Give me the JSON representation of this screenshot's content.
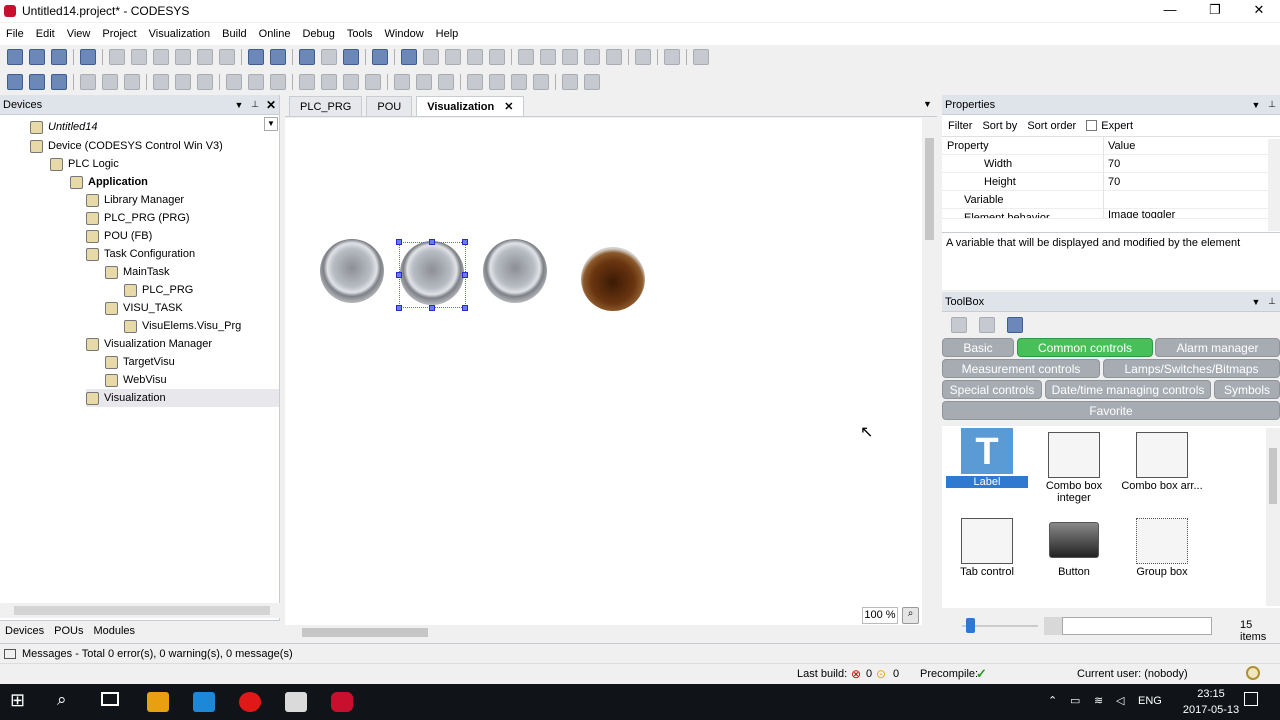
{
  "window": {
    "title": "Untitled14.project* - CODESYS",
    "min_glyph": "—",
    "max_glyph": "❐",
    "close_glyph": "✕"
  },
  "menu": [
    "File",
    "Edit",
    "View",
    "Project",
    "Visualization",
    "Build",
    "Online",
    "Debug",
    "Tools",
    "Window",
    "Help"
  ],
  "devices_panel": {
    "title": "Devices",
    "tree": [
      {
        "label": "Untitled14",
        "indent": 0
      },
      {
        "label": "Device (CODESYS Control Win V3)",
        "indent": 1
      },
      {
        "label": "PLC Logic",
        "indent": 2
      },
      {
        "label": "Application",
        "indent": 3
      },
      {
        "label": "Library Manager",
        "indent": 4
      },
      {
        "label": "PLC_PRG (PRG)",
        "indent": 4
      },
      {
        "label": "POU (FB)",
        "indent": 4
      },
      {
        "label": "Task Configuration",
        "indent": 4
      },
      {
        "label": "MainTask",
        "indent": 5
      },
      {
        "label": "PLC_PRG",
        "indent": 6
      },
      {
        "label": "VISU_TASK",
        "indent": 5
      },
      {
        "label": "VisuElems.Visu_Prg",
        "indent": 6
      },
      {
        "label": "Visualization Manager",
        "indent": 4
      },
      {
        "label": "TargetVisu",
        "indent": 5
      },
      {
        "label": "WebVisu",
        "indent": 5
      },
      {
        "label": "Visualization",
        "indent": 4
      }
    ],
    "bottom_tabs": [
      "Devices",
      "POUs",
      "Modules"
    ]
  },
  "editor": {
    "tabs": [
      "PLC_PRG",
      "POU",
      "Visualization"
    ],
    "active_tab": "Visualization",
    "zoom": "100 %"
  },
  "properties": {
    "title": "Properties",
    "toolbar": [
      "Filter",
      "Sort by",
      "Sort order",
      "Expert"
    ],
    "columns": [
      "Property",
      "Value"
    ],
    "rows": [
      {
        "key": "Width",
        "value": "70"
      },
      {
        "key": "Height",
        "value": "70"
      },
      {
        "key": "Variable",
        "value": ""
      },
      {
        "key": "Element behavior",
        "value": "Image toggler"
      }
    ],
    "description": "A variable that will be displayed and modified by the element"
  },
  "toolbox": {
    "title": "ToolBox",
    "categories": [
      "Basic",
      "Common controls",
      "Alarm manager",
      "Measurement controls",
      "Lamps/Switches/Bitmaps",
      "Special controls",
      "Date/time managing controls",
      "Symbols",
      "Favorite"
    ],
    "active_category": "Common controls",
    "items": [
      "Label",
      "Combo box integer",
      "Combo box arr...",
      "Tab control",
      "Button",
      "Group box"
    ],
    "count": "15 items"
  },
  "messages": "Messages - Total 0 error(s), 0 warning(s), 0 message(s)",
  "status": {
    "last_build": "Last build:",
    "errors": "0",
    "warnings": "0",
    "precompile": "Precompile:",
    "current_user": "Current user: (nobody)"
  },
  "taskbar": {
    "lang": "ENG",
    "time": "23:15",
    "date": "2017-05-13"
  }
}
